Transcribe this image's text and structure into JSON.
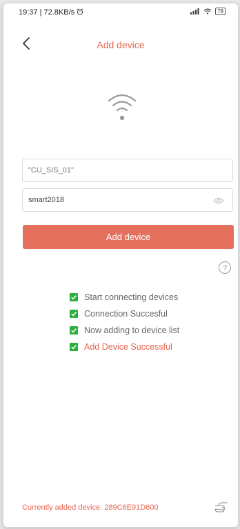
{
  "status_bar": {
    "time_speed": "19:37 | 72.8KB/s",
    "alarm_icon": "alarm-clock-icon",
    "signal_icon": "signal-bars-icon",
    "wifi_icon": "wifi-icon",
    "battery": "78"
  },
  "header": {
    "back_icon": "chevron-left-icon",
    "title": "Add device"
  },
  "form": {
    "ssid_value": "\"CU_SIS_01\"",
    "password_value": "smart2018",
    "eye_icon": "eye-icon",
    "submit_label": "Add device"
  },
  "help_icon": "question-circle-icon",
  "steps": [
    "Start connecting devices",
    "Connection Succesful",
    "Now adding to device list",
    "Add Device Successful"
  ],
  "footer": {
    "current_device": "Currently added device: 289C6E91D600",
    "hand_icon": "pointing-hand-icon"
  },
  "colors": {
    "accent": "#e5644d",
    "button": "#e5705d",
    "check": "#2eae3e"
  }
}
